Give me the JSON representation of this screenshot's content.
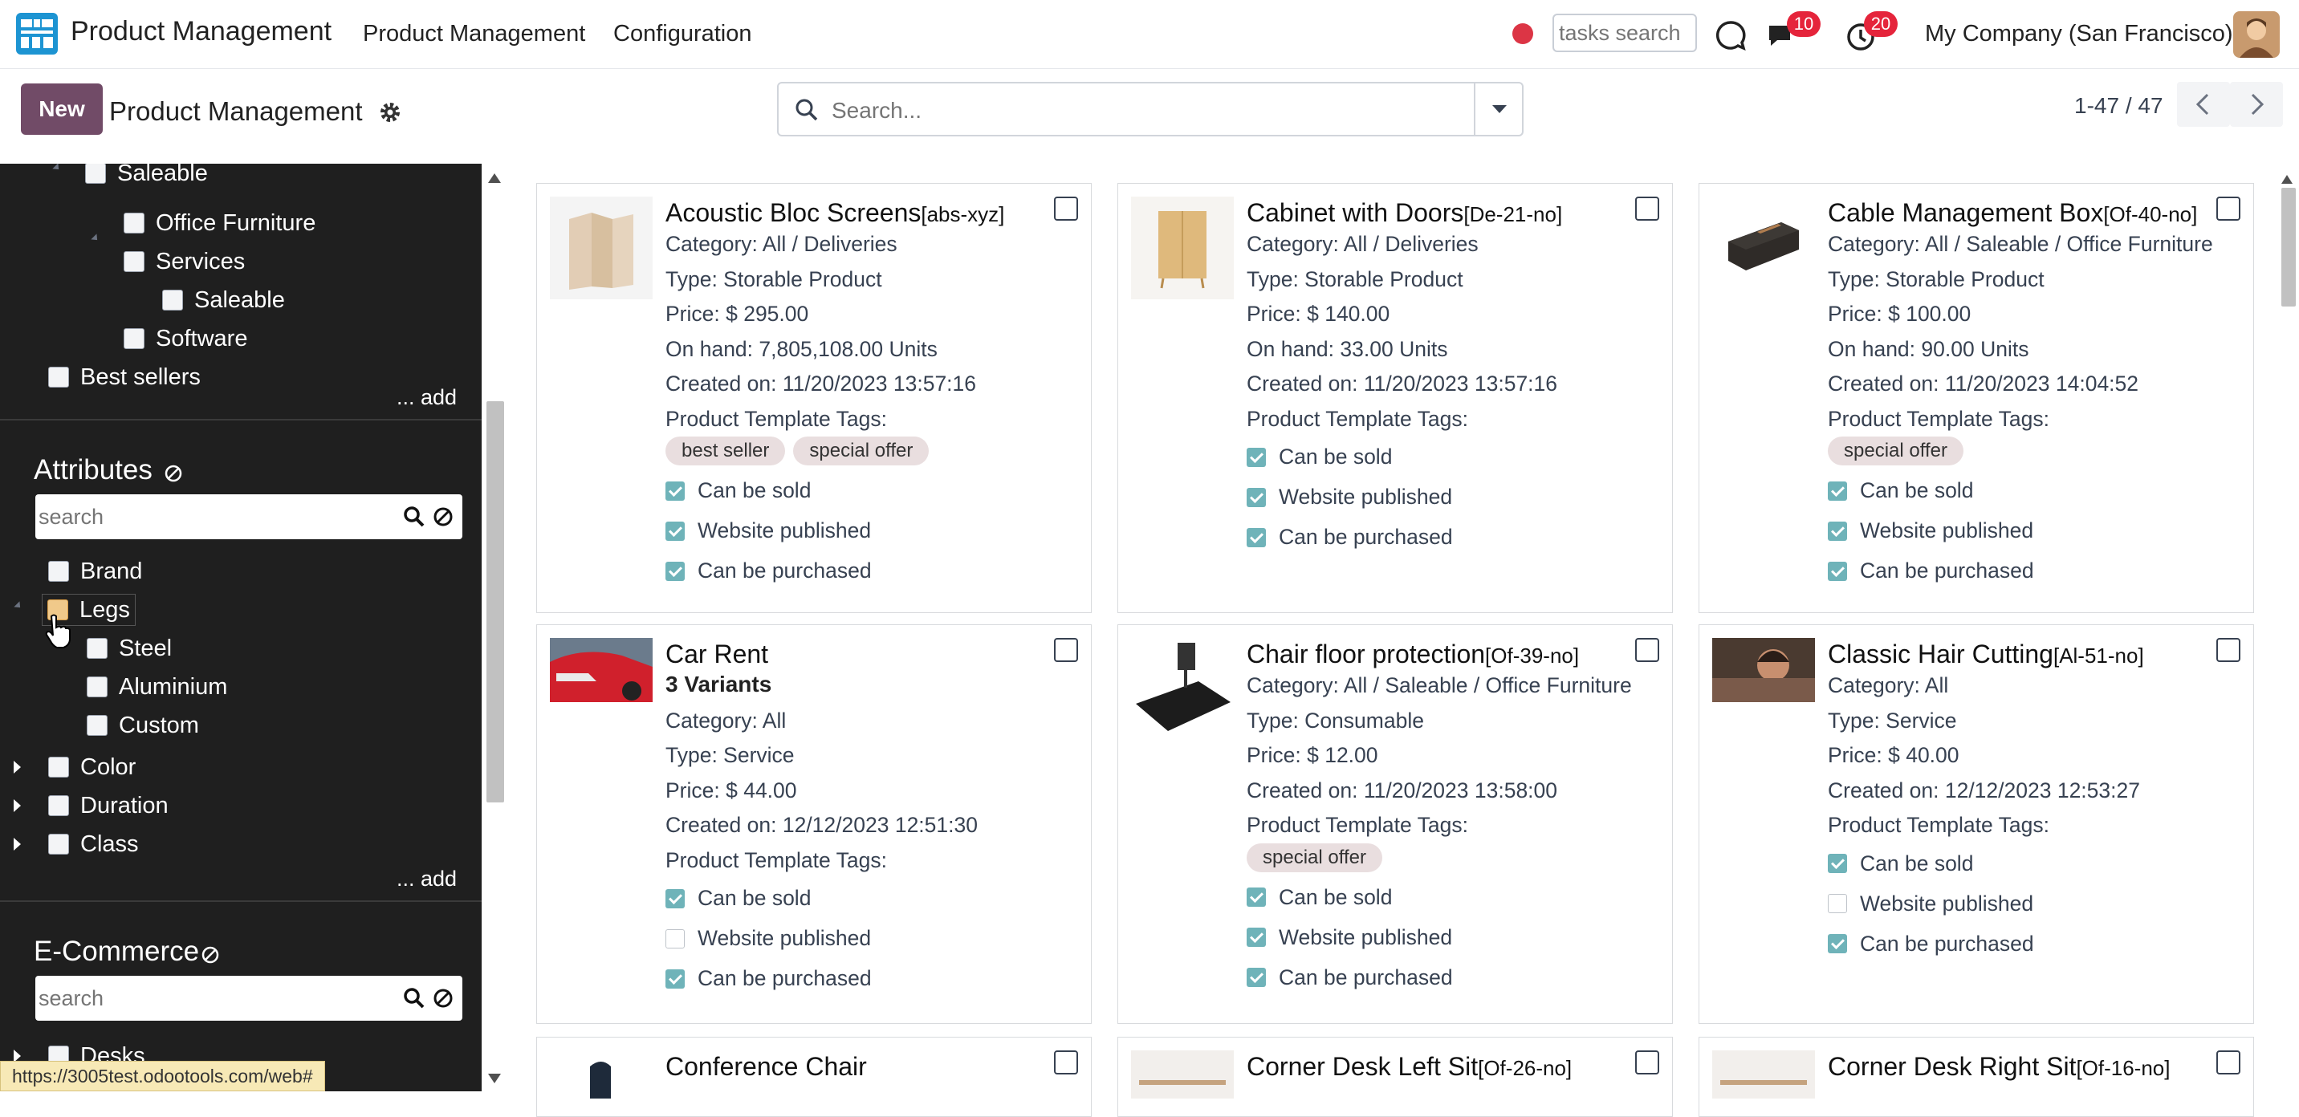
{
  "navbar": {
    "app_name": "Product Management",
    "menus": [
      "Product Management",
      "Configuration"
    ],
    "tasks_search_placeholder": "tasks search",
    "messages_badge": "10",
    "activities_badge": "20",
    "company": "My Company (San Francisco)"
  },
  "control_panel": {
    "new_label": "New",
    "title": "Product Management",
    "search_placeholder": "Search...",
    "pager": "1-47 / 47"
  },
  "sidebar": {
    "categories": [
      "Saleable",
      "Office Furniture",
      "Services",
      "Saleable",
      "Software",
      "Best sellers"
    ],
    "add_label": "... add",
    "attributes_heading": "Attributes",
    "attributes_search_placeholder": "search",
    "attributes": [
      "Brand",
      "Legs",
      "Steel",
      "Aluminium",
      "Custom",
      "Color",
      "Duration",
      "Class"
    ],
    "ecommerce_heading": "E-Commerce",
    "ecommerce_search_placeholder": "search",
    "ecommerce_items": [
      "Desks"
    ],
    "status_url": "https://3005test.odootools.com/web#"
  },
  "flags": {
    "sold": "Can be sold",
    "published": "Website published",
    "purchased": "Can be purchased"
  },
  "tags_label": "Product Template Tags:",
  "cards": [
    {
      "name": "Acoustic Bloc Screens",
      "code": "[abs-xyz]",
      "category": "Category: All / Deliveries",
      "type": "Type: Storable Product",
      "price": "Price: $ 295.00",
      "on_hand": "On hand: 7,805,108.00 Units",
      "created": "Created on: 11/20/2023 13:57:16",
      "tags": [
        "best seller",
        "special offer"
      ],
      "sold": true,
      "published": true,
      "purchased": true
    },
    {
      "name": "Cabinet with Doors",
      "code": "[De-21-no]",
      "category": "Category: All / Deliveries",
      "type": "Type: Storable Product",
      "price": "Price: $ 140.00",
      "on_hand": "On hand: 33.00 Units",
      "created": "Created on: 11/20/2023 13:57:16",
      "tags": [],
      "sold": true,
      "published": true,
      "purchased": true
    },
    {
      "name": "Cable Management Box",
      "code": "[Of-40-no]",
      "category": "Category: All / Saleable / Office Furniture",
      "type": "Type: Storable Product",
      "price": "Price: $ 100.00",
      "on_hand": "On hand: 90.00 Units",
      "created": "Created on: 11/20/2023 14:04:52",
      "tags": [
        "special offer"
      ],
      "sold": true,
      "published": true,
      "purchased": true
    },
    {
      "name": "Car Rent",
      "code": "",
      "variants": "3 Variants",
      "category": "Category: All",
      "type": "Type: Service",
      "price": "Price: $ 44.00",
      "created": "Created on: 12/12/2023 12:51:30",
      "tags": [],
      "sold": true,
      "published": false,
      "purchased": true
    },
    {
      "name": "Chair floor protection",
      "code": "[Of-39-no]",
      "category": "Category: All / Saleable / Office Furniture",
      "type": "Type: Consumable",
      "price": "Price: $ 12.00",
      "created": "Created on: 11/20/2023 13:58:00",
      "tags": [
        "special offer"
      ],
      "sold": true,
      "published": true,
      "purchased": true
    },
    {
      "name": "Classic Hair Cutting",
      "code": "[Al-51-no]",
      "category": "Category: All",
      "type": "Type: Service",
      "price": "Price: $ 40.00",
      "created": "Created on: 12/12/2023 12:53:27",
      "tags": [],
      "sold": true,
      "published": false,
      "purchased": true
    },
    {
      "name": "Conference Chair",
      "code": ""
    },
    {
      "name": "Corner Desk Left Sit",
      "code": "[Of-26-no]"
    },
    {
      "name": "Corner Desk Right Sit",
      "code": "[Of-16-no]"
    }
  ]
}
